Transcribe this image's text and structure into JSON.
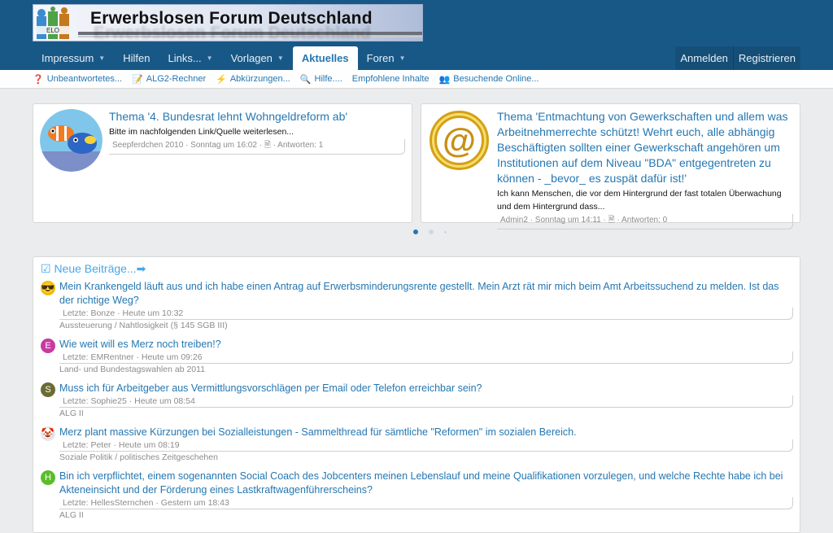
{
  "site": {
    "logo_text": "Erwerbslosen Forum Deutschland",
    "logo_mark": "ELO"
  },
  "nav": {
    "items": [
      {
        "label": "Impressum",
        "caret": true
      },
      {
        "label": "Hilfen",
        "caret": false
      },
      {
        "label": "Links...",
        "caret": true
      },
      {
        "label": "Vorlagen",
        "caret": true
      },
      {
        "label": "Aktuelles",
        "caret": false,
        "active": true
      },
      {
        "label": "Foren",
        "caret": true
      }
    ],
    "login": "Anmelden",
    "register": "Registrieren"
  },
  "subnav": {
    "items": [
      {
        "icon": "❓",
        "label": "Unbeantwortetes..."
      },
      {
        "icon": "📝",
        "label": "ALG2-Rechner"
      },
      {
        "icon": "⚡",
        "label": "Abkürzungen..."
      },
      {
        "icon": "🔍",
        "label": "Hilfe...."
      },
      {
        "icon": "",
        "label": "Empfohlene Inhalte"
      },
      {
        "icon": "👥",
        "label": "Besuchende Online..."
      }
    ]
  },
  "featured": [
    {
      "title": "Thema '4. Bundesrat lehnt Wohngeldreform ab'",
      "snippet": "Bitte im nachfolgenden Link/Quelle weiterlesen...",
      "meta": "Seepferdchen 2010 · Sonntag um 16:02 · 🗎 · Antworten: 1"
    },
    {
      "title": "Thema 'Entmachtung von Gewerkschaften und allem was Arbeitnehmerrechte schützt! Wehrt euch, alle abhängig Beschäftigten sollten einer Gewerkschaft angehören um Institutionen auf dem Niveau \"BDA\" entgegentreten zu können - _bevor_ es zuspät dafür ist!'",
      "snippet": "Ich kann Menschen, die vor dem Hintergrund der fast totalen Überwachung und dem Hintergrund dass...",
      "meta": "Admin2 · Sonntag um 14:11 · 🗎 · Antworten: 0"
    }
  ],
  "new_posts": {
    "heading": "☑ Neue Beiträge...➡",
    "items": [
      {
        "avatar": "😎",
        "avatar_color": "#f2c200",
        "title": "Mein Krankengeld läuft aus und ich habe einen Antrag auf Erwerbsminderungsrente gestellt. Mein Arzt rät mir mich beim Amt Arbeitssuchend zu melden. Ist das der richtige Weg?",
        "meta": "Letzte: Bonze · Heute um 10:32",
        "forum": "Aussteuerung / Nahtlosigkeit (§ 145 SGB III)"
      },
      {
        "avatar": "E",
        "avatar_color": "#c63ba1",
        "title": "Wie weit will es Merz noch treiben!?",
        "meta": "Letzte: EMRentner · Heute um 09:26",
        "forum": "Land- und Bundestagswahlen ab 2011"
      },
      {
        "avatar": "S",
        "avatar_color": "#6b6b34",
        "title": "Muss ich für Arbeitgeber aus Vermittlungsvorschlägen per Email oder Telefon erreichbar sein?",
        "meta": "Letzte: Sophie25 · Heute um 08:54",
        "forum": "ALG II"
      },
      {
        "avatar": "🤡",
        "avatar_color": "#e8e8e8",
        "title": "Merz plant massive Kürzungen bei Sozialleistungen - Sammelthread für sämtliche \"Reformen\" im sozialen Bereich.",
        "meta": "Letzte: Peter · Heute um 08:19",
        "forum": "Soziale Politik / politisches Zeitgeschehen"
      },
      {
        "avatar": "H",
        "avatar_color": "#5bbd2b",
        "title": "Bin ich verpflichtet, einem sogenannten Social Coach des Jobcenters meinen Lebenslauf und meine Qualifikationen vorzulegen, und welche Rechte habe ich bei Akteneinsicht und der Förderung eines Lastkraftwagenführerscheins?",
        "meta": "Letzte: HellesSternchen · Gestern um 18:43",
        "forum": "ALG II"
      }
    ]
  },
  "colors": {
    "header": "#185886",
    "link": "#2577b1",
    "accent": "#47a7eb"
  }
}
